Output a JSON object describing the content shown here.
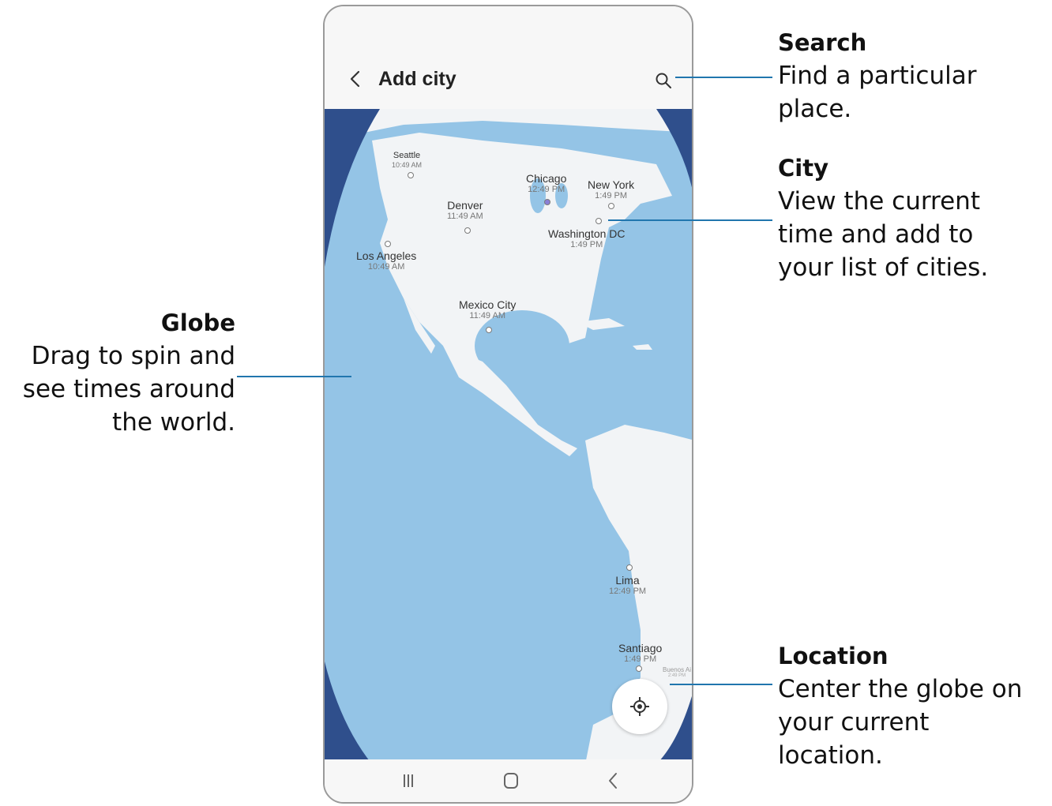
{
  "app": {
    "title": "Add city"
  },
  "cities": [
    {
      "name": "Seattle",
      "time": "10:49 AM"
    },
    {
      "name": "Chicago",
      "time": "12:49 PM"
    },
    {
      "name": "New York",
      "time": "1:49 PM"
    },
    {
      "name": "Denver",
      "time": "11:49 AM"
    },
    {
      "name": "Washington DC",
      "time": "1:49 PM"
    },
    {
      "name": "Los Angeles",
      "time": "10:49 AM"
    },
    {
      "name": "Mexico City",
      "time": "11:49 AM"
    },
    {
      "name": "Lima",
      "time": "12:49 PM"
    },
    {
      "name": "Santiago",
      "time": "1:49 PM"
    },
    {
      "name": "Buenos Ai",
      "time": "2:49 PM"
    }
  ],
  "callouts": {
    "search": {
      "heading": "Search",
      "lines": [
        "Find a particular",
        "place."
      ]
    },
    "city": {
      "heading": "City",
      "lines": [
        "View the current",
        "time and add to",
        "your list of cities."
      ]
    },
    "globe": {
      "heading": "Globe",
      "lines": [
        "Drag to spin and",
        "see times around",
        "the world."
      ]
    },
    "location": {
      "heading": "Location",
      "lines": [
        "Center the globe on",
        "your current",
        "location."
      ]
    }
  },
  "icons": {
    "back": "chevron-left-icon",
    "search": "search-icon",
    "location": "crosshair-location-icon",
    "recents": "recents-icon",
    "home": "home-icon",
    "nav_back": "nav-back-icon"
  },
  "colors": {
    "ocean": "#94c4e6",
    "land": "#f2f4f6",
    "space": "#2f4f8c",
    "callout_line": "#2176ae"
  }
}
